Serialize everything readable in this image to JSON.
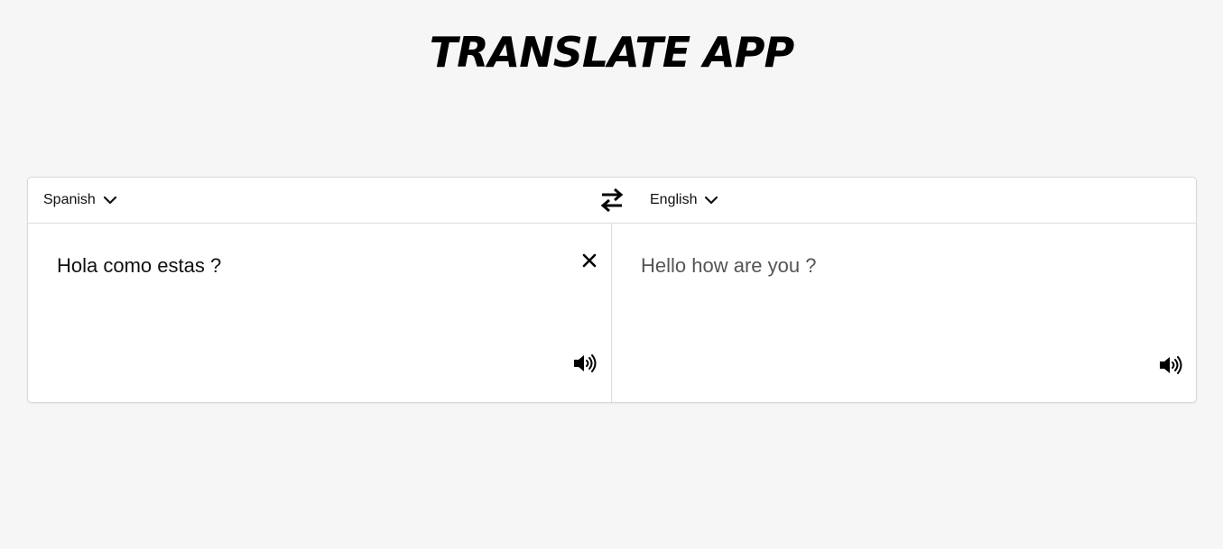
{
  "app": {
    "title": "TRANSLATE APP"
  },
  "source": {
    "language": "Spanish",
    "text": "Hola como estas ?"
  },
  "target": {
    "language": "English",
    "text": "Hello how are you ?"
  },
  "icons": {
    "swap": "swap-arrows-icon",
    "clear": "close-icon",
    "speaker": "speaker-icon",
    "dropdown": "chevron-down-icon"
  },
  "colors": {
    "background": "#f6f6f6",
    "card": "#ffffff",
    "border": "#dcdcdc",
    "source_text": "#111111",
    "target_text": "#555555"
  }
}
